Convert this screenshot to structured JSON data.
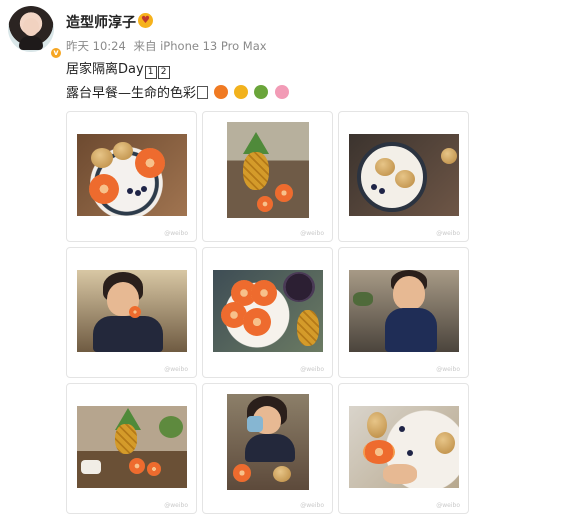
{
  "post": {
    "username": "造型师淳子",
    "rank_badge": "♥",
    "verified_mark": "v",
    "time": "昨天 10:24",
    "source": "来自 iPhone 13 Pro Max",
    "line1_text": "居家隔离Day",
    "line1_keycaps": [
      "1",
      "2"
    ],
    "line2_text": "露台早餐—生命的色彩",
    "emojis": [
      {
        "name": "orange-emoji",
        "color": "#f07a22"
      },
      {
        "name": "mango-emoji",
        "color": "#f2b21d"
      },
      {
        "name": "avocado-emoji",
        "color": "#6aa53a"
      },
      {
        "name": "flower-emoji",
        "color": "#f29bb6"
      }
    ]
  },
  "photos": [
    {
      "name": "photo-orange-plate",
      "watermark": "@weibo"
    },
    {
      "name": "photo-pineapple-table",
      "watermark": "@weibo"
    },
    {
      "name": "photo-alphabet-plate",
      "watermark": "@weibo"
    },
    {
      "name": "photo-girl-eating",
      "watermark": "@weibo"
    },
    {
      "name": "photo-orange-slices",
      "watermark": "@weibo"
    },
    {
      "name": "photo-boy-smiling",
      "watermark": "@weibo"
    },
    {
      "name": "photo-terrace-table",
      "watermark": "@weibo"
    },
    {
      "name": "photo-girl-drinking",
      "watermark": "@weibo"
    },
    {
      "name": "photo-hand-orange",
      "watermark": "@weibo"
    }
  ]
}
